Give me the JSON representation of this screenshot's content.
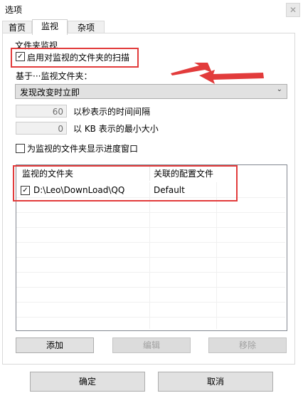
{
  "window": {
    "title": "选项",
    "close_glyph": "✕"
  },
  "tabs": [
    {
      "label": "首页",
      "active": false
    },
    {
      "label": "监视",
      "active": true
    },
    {
      "label": "杂项",
      "active": false
    }
  ],
  "group": {
    "label": "文件夹监视"
  },
  "enable_scan": {
    "label": "启用对监视的文件夹的扫描",
    "checked": true,
    "check_glyph": "✓"
  },
  "based_on": {
    "label": "基于···监视文件夹："
  },
  "mode_select": {
    "value": "发现改变时立即",
    "arrow_glyph": "⌄"
  },
  "interval": {
    "value": "60",
    "label": "以秒表示的时间间隔"
  },
  "min_size": {
    "value": "0",
    "label": "以 KB 表示的最小大小"
  },
  "show_progress": {
    "label": "为监视的文件夹显示进度窗口",
    "checked": false
  },
  "folder_list": {
    "columns": [
      "监视的文件夹",
      "关联的配置文件"
    ],
    "rows": [
      {
        "checked": true,
        "folder": "D:\\Leo\\DownLoad\\QQ",
        "profile": "Default"
      }
    ]
  },
  "list_buttons": {
    "add": "添加",
    "edit": "编辑",
    "remove": "移除"
  },
  "dialog_buttons": {
    "ok": "确定",
    "cancel": "取消"
  },
  "colors": {
    "annotation_red": "#e23b3b"
  }
}
